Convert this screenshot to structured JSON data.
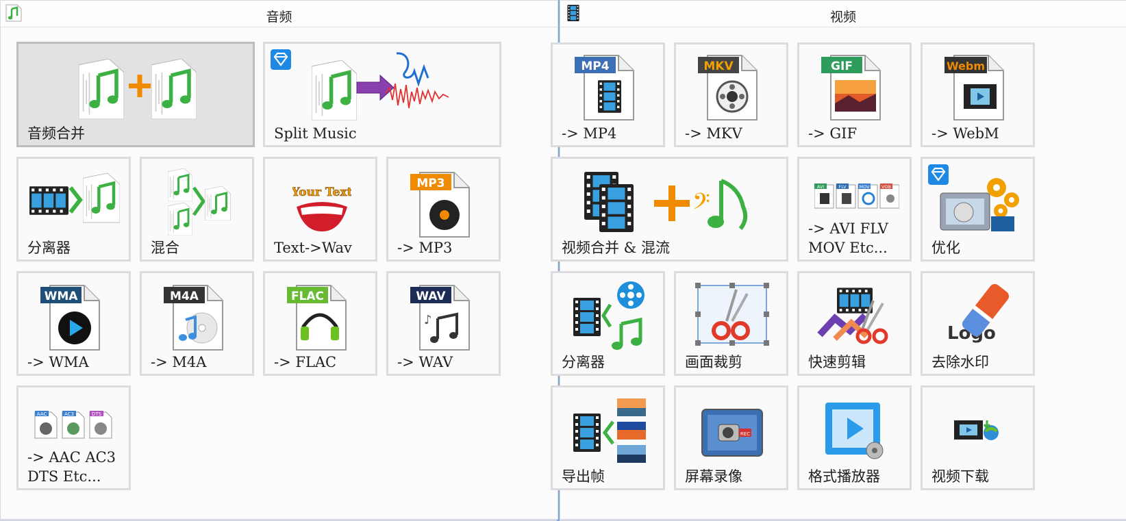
{
  "audio": {
    "title": "音频",
    "title_icon": "music-note-icon",
    "tiles": [
      {
        "label": "音频合并",
        "icon": "merge-audio-icon",
        "selected": true
      },
      {
        "label": "Split Music",
        "icon": "split-music-icon",
        "premium": true
      },
      {
        "label": "分离器",
        "icon": "audio-splitter-icon"
      },
      {
        "label": "混合",
        "icon": "mix-icon"
      },
      {
        "label": "Text->Wav",
        "icon": "text-to-wav-icon",
        "art_text": "Your Text"
      },
      {
        "label": "-> MP3",
        "icon": "mp3-file-icon",
        "tag": "MP3",
        "tag_color": "#f08a00"
      },
      {
        "label": "-> WMA",
        "icon": "wma-file-icon",
        "tag": "WMA",
        "tag_color": "#1f4e79"
      },
      {
        "label": "-> M4A",
        "icon": "m4a-file-icon",
        "tag": "M4A",
        "tag_color": "#333333"
      },
      {
        "label": "-> FLAC",
        "icon": "flac-file-icon",
        "tag": "FLAC",
        "tag_color": "#66bb33"
      },
      {
        "label": "-> WAV",
        "icon": "wav-file-icon",
        "tag": "WAV",
        "tag_color": "#1d2b57"
      },
      {
        "label": "-> AAC AC3\nDTS Etc...",
        "icon": "aac-ac3-dts-icon",
        "mini_tags": [
          "AAC",
          "AC3",
          "DTS"
        ]
      }
    ]
  },
  "video": {
    "title": "视频",
    "title_icon": "film-icon",
    "tiles": [
      {
        "label": "-> MP4",
        "icon": "mp4-file-icon",
        "tag": "MP4",
        "tag_color": "#3c6fb4"
      },
      {
        "label": "-> MKV",
        "icon": "mkv-file-icon",
        "tag": "MKV",
        "tag_color": "#444444"
      },
      {
        "label": "-> GIF",
        "icon": "gif-file-icon",
        "tag": "GIF",
        "tag_color": "#2e9c5a"
      },
      {
        "label": "-> WebM",
        "icon": "webm-file-icon",
        "tag": "Webm",
        "tag_color": "#333333"
      },
      {
        "label": "视频合并 & 混流",
        "icon": "merge-video-icon"
      },
      {
        "label": "-> AVI FLV\nMOV Etc...",
        "icon": "avi-flv-mov-icon",
        "mini_tags": [
          "AVI",
          "FLV",
          "MOV",
          "VOB"
        ]
      },
      {
        "label": "优化",
        "icon": "optimize-icon",
        "premium": true
      },
      {
        "label": "分离器",
        "icon": "video-splitter-icon"
      },
      {
        "label": "画面裁剪",
        "icon": "crop-icon"
      },
      {
        "label": "快速剪辑",
        "icon": "quick-cut-icon"
      },
      {
        "label": "去除水印",
        "icon": "remove-watermark-icon",
        "art_text": "Logo"
      },
      {
        "label": "导出帧",
        "icon": "export-frames-icon"
      },
      {
        "label": "屏幕录像",
        "icon": "screen-record-icon",
        "art_text": "REC"
      },
      {
        "label": "格式播放器",
        "icon": "format-player-icon"
      },
      {
        "label": "视频下载",
        "icon": "video-download-icon"
      }
    ]
  },
  "colors": {
    "accent": "#7fa6dc",
    "tile_border": "#dcdcdc",
    "selected_bg": "#e2e2e2",
    "note_green": "#3cb043",
    "premium_blue": "#1e88e5"
  }
}
